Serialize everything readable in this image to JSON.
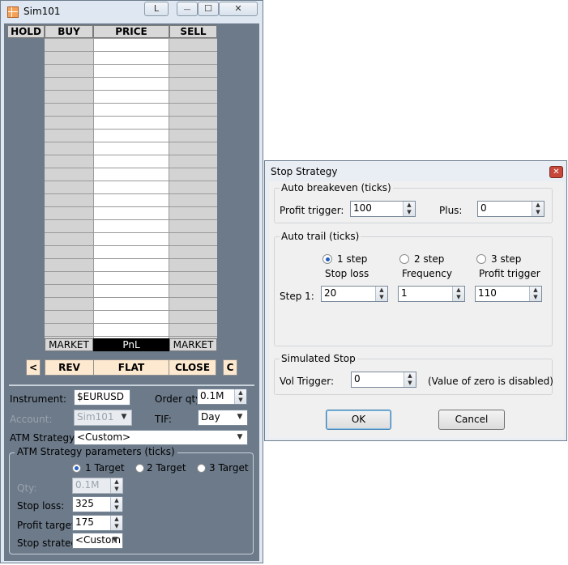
{
  "main_window": {
    "title": "Sim101",
    "buttons": {
      "l_label": "L",
      "minimize_glyph": "—",
      "maximize_glyph": "☐",
      "close_glyph": "✕"
    },
    "ladder": {
      "hold_label": "HOLD",
      "columns": {
        "buy": "BUY",
        "price": "PRICE",
        "sell": "SELL"
      },
      "footer": {
        "buy": "MARKET",
        "price": "PnL",
        "sell": "MARKET"
      }
    },
    "actions": {
      "left_arrow": "<",
      "rev": "REV",
      "flat": "FLAT",
      "close": "CLOSE",
      "c": "C"
    },
    "instrument_label": "Instrument:",
    "instrument_value": "$EURUSD",
    "order_qty_label": "Order qty:",
    "order_qty_value": "0.1M",
    "account_label": "Account:",
    "account_value": "Sim101",
    "tif_label": "TIF:",
    "tif_value": "Day",
    "atm_strategy_label": "ATM Strategy:",
    "atm_strategy_value": "<Custom>",
    "atm_params": {
      "title": "ATM Strategy parameters (ticks)",
      "targets": [
        "1 Target",
        "2 Target",
        "3 Target"
      ],
      "qty_label": "Qty:",
      "qty_value": "0.1M",
      "stop_loss_label": "Stop loss:",
      "stop_loss_value": "325",
      "profit_target_label": "Profit target:",
      "profit_target_value": "175",
      "stop_strategy_label": "Stop strategy:",
      "stop_strategy_value": "<Custom"
    }
  },
  "stop_strategy_dialog": {
    "title": "Stop Strategy",
    "close_glyph": "✕",
    "auto_breakeven": {
      "title": "Auto breakeven (ticks)",
      "profit_trigger_label": "Profit trigger:",
      "profit_trigger_value": "100",
      "plus_label": "Plus:",
      "plus_value": "0"
    },
    "auto_trail": {
      "title": "Auto trail (ticks)",
      "steps": [
        "1 step",
        "2 step",
        "3 step"
      ],
      "col_headers": [
        "Stop loss",
        "Frequency",
        "Profit trigger"
      ],
      "step1_label": "Step 1:",
      "stop_loss_value": "20",
      "frequency_value": "1",
      "profit_trigger_value": "110"
    },
    "simulated_stop": {
      "title": "Simulated Stop",
      "vol_trigger_label": "Vol Trigger:",
      "vol_trigger_value": "0",
      "note": "(Value of zero is disabled)"
    },
    "ok_label": "OK",
    "cancel_label": "Cancel"
  }
}
